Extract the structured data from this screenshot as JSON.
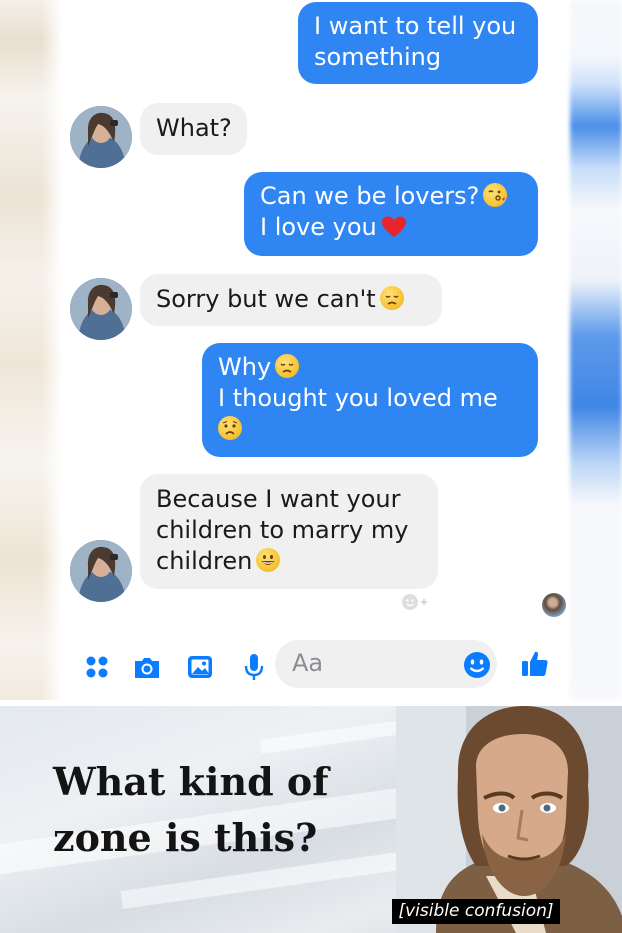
{
  "conversation": {
    "messages": [
      {
        "from": "me",
        "lines": [
          "I want to tell you",
          "something"
        ]
      },
      {
        "from": "contact",
        "lines": [
          "What?"
        ]
      },
      {
        "from": "me",
        "lines": [
          "Can we be lovers?",
          "I love you"
        ],
        "emoji": [
          "face-blowing-kiss",
          "red-heart"
        ]
      },
      {
        "from": "contact",
        "lines": [
          "Sorry but we can't"
        ],
        "emoji": [
          "disappointed-face"
        ]
      },
      {
        "from": "me",
        "lines": [
          "Why",
          "I thought you loved me",
          ""
        ],
        "emoji": [
          "disappointed-face",
          "worried-face"
        ]
      },
      {
        "from": "contact",
        "lines": [
          "Because I want your",
          "children to marry my",
          "children"
        ],
        "emoji": [
          "grinning-face"
        ]
      }
    ]
  },
  "composer": {
    "placeholder": "Aa",
    "icons": [
      "menu-dots-icon",
      "camera-icon",
      "gallery-icon",
      "microphone-icon",
      "emoji-icon",
      "thumbs-up-icon"
    ]
  },
  "meme": {
    "text": "What kind of zone is this?",
    "caption": "[visible confusion]"
  },
  "colors": {
    "outgoing_bubble": "#2f86f2",
    "incoming_bubble": "#f0f0f0",
    "messenger_icon": "#0a7cff"
  }
}
